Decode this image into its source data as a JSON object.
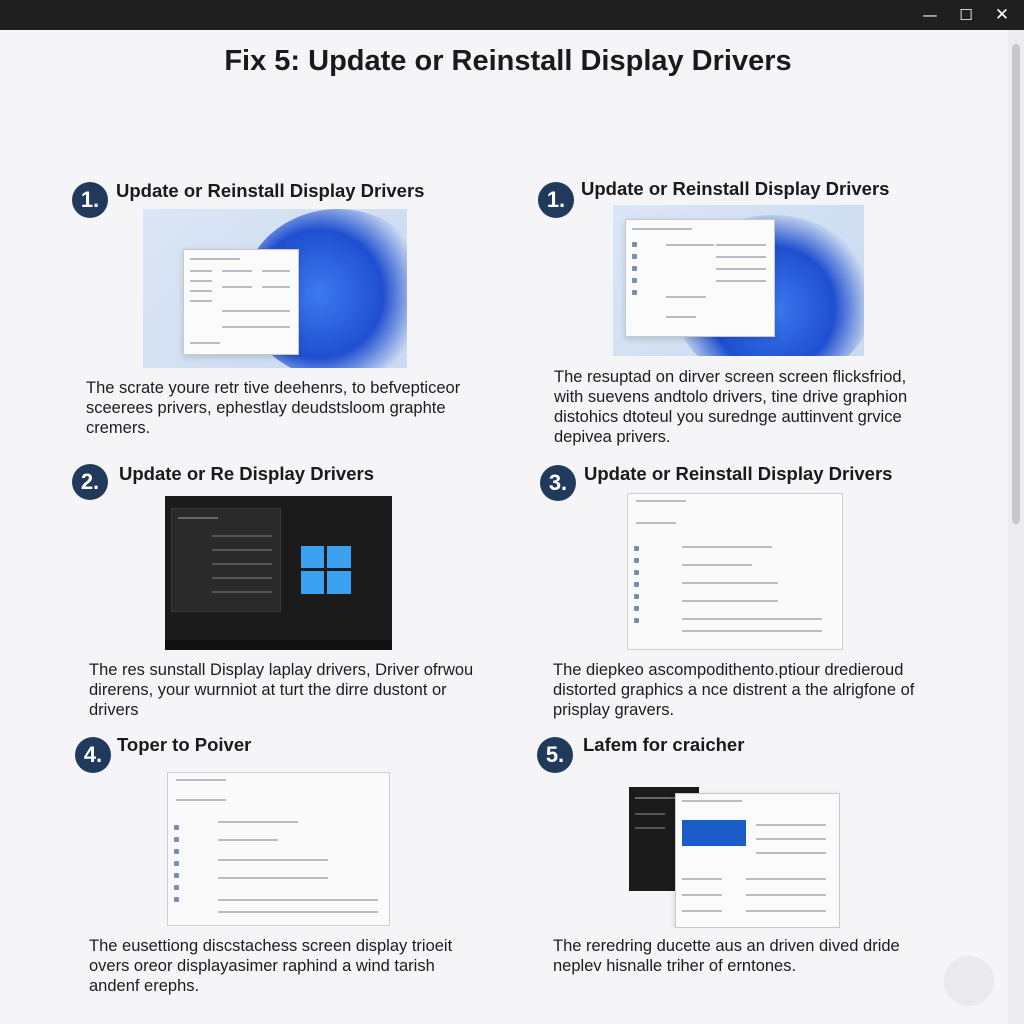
{
  "window": {
    "minimize_glyph": "—",
    "maximize_glyph": "☐",
    "close_glyph": "✕"
  },
  "page": {
    "title": "Fix 5: Update or Reinstall Display Drivers"
  },
  "steps": [
    {
      "badge": "1.",
      "title": "Update or Reinstall Display Drivers",
      "description": "The scrate youre retr tive deehenrs, to befvepticeor sceerees privers, ephestlay deudstsloom graphte cremers.",
      "screenshot": "windows-11-settings-window"
    },
    {
      "badge": "1.",
      "title": "Update or Reinstall Display Drivers",
      "description": "The resuptad on dirver screen screen flicksfriod, with suevens andtolo drivers, tine drive graphion distohics dtoteul you surednge auttinvent grvice depivea privers.",
      "screenshot": "windows-11-device-manager-window"
    },
    {
      "badge": "2.",
      "title": "Update or Re Display Drivers",
      "description": "The res sunstall Display laplay drivers, Driver ofrwou direrens, your wurnniot at turt the dirre dustont or drivers",
      "screenshot": "dark-settings-window"
    },
    {
      "badge": "3.",
      "title": "Update or Reinstall Display Drivers",
      "description": "The diepkeo ascompodithento.ptiour dredieroud distorted graphics a nce distrent a the alrigfone of prisplay gravers.",
      "screenshot": "device-manager-driver-update-window"
    },
    {
      "badge": "4.",
      "title": "Toper to Poiver",
      "description": "The eusettiong discstachess screen display trioeit overs oreor displayasimer raphind a wind tarish andenf erephs.",
      "screenshot": "device-manager-properties-window"
    },
    {
      "badge": "5.",
      "title": "Lafem for craicher",
      "description": "The reredring ducette aus an driven dived dride neplev hisnalle triher of erntones.",
      "screenshot": "driver-download-window"
    }
  ]
}
